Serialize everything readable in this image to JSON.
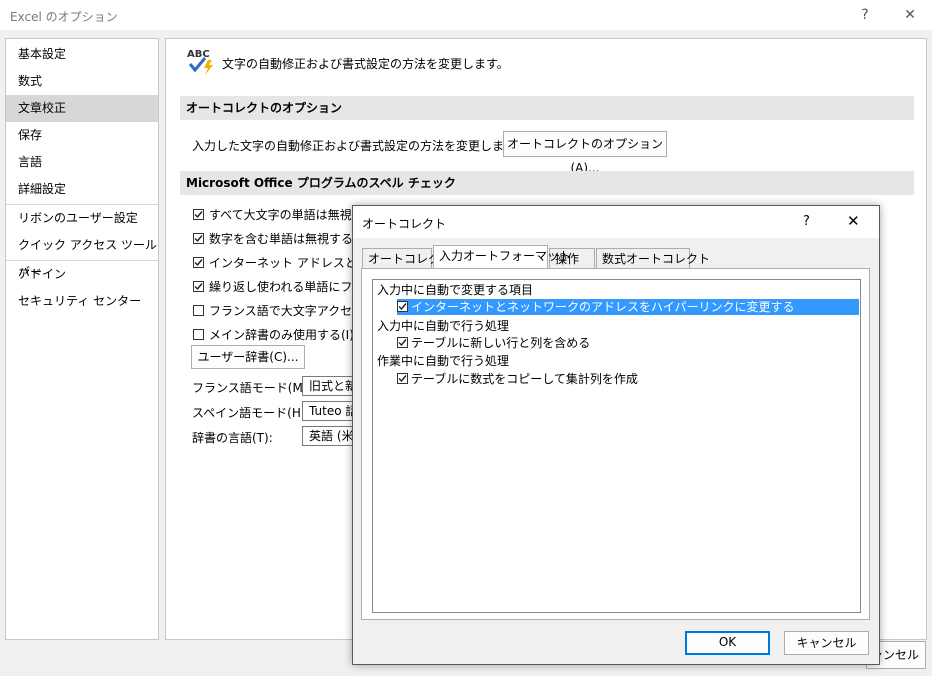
{
  "window": {
    "title": "Excel のオプション",
    "help": "?",
    "close": "✕"
  },
  "sidebar": {
    "items": [
      "基本設定",
      "数式",
      "文章校正",
      "保存",
      "言語",
      "詳細設定",
      "リボンのユーザー設定",
      "クイック アクセス ツール バー",
      "アドイン",
      "セキュリティ センター"
    ]
  },
  "content": {
    "header_text": "文字の自動修正および書式設定の方法を変更します。",
    "autocorrect_section": "オートコレクトのオプション",
    "autocorrect_desc": "入力した文字の自動修正および書式設定の方法を変更します:",
    "autocorrect_button": "オートコレクトのオプション(A)...",
    "spell_section": "Microsoft Office プログラムのスペル チェック",
    "checks": [
      {
        "label": "すべて大文字の単語は無視す",
        "checked": true
      },
      {
        "label": "数字を含む単語は無視する(E",
        "checked": true
      },
      {
        "label": "インターネット アドレスとファイル",
        "checked": true
      },
      {
        "label": "繰り返し使われる単語にフラグ",
        "checked": true
      },
      {
        "label": "フランス語で大文字アクセント",
        "checked": false
      },
      {
        "label": "メイン辞書のみ使用する(I)",
        "checked": false
      }
    ],
    "user_dict_button": "ユーザー辞書(C)...",
    "fields": [
      {
        "label": "フランス語モード(M):",
        "value": "旧式と新"
      },
      {
        "label": "スペイン語モード(H):",
        "value": "Tuteo 話"
      },
      {
        "label": "辞書の言語(T):",
        "value": "英語 (米"
      }
    ],
    "cancel_partial": "ャンセル"
  },
  "dialog": {
    "title": "オートコレクト",
    "help": "?",
    "close": "✕",
    "tabs": [
      "オートコレクト",
      "入力オートフォーマット",
      "操作",
      "数式オートコレクト"
    ],
    "active_tab": 1,
    "groups": [
      {
        "heading": "入力中に自動で変更する項目",
        "options": [
          {
            "label": "インターネットとネットワークのアドレスをハイパーリンクに変更する",
            "checked": true,
            "highlighted": true
          }
        ]
      },
      {
        "heading": "入力中に自動で行う処理",
        "options": [
          {
            "label": "テーブルに新しい行と列を含める",
            "checked": true,
            "highlighted": false
          }
        ]
      },
      {
        "heading": "作業中に自動で行う処理",
        "options": [
          {
            "label": "テーブルに数式をコピーして集計列を作成",
            "checked": true,
            "highlighted": false
          }
        ]
      }
    ],
    "ok": "OK",
    "cancel": "キャンセル"
  }
}
